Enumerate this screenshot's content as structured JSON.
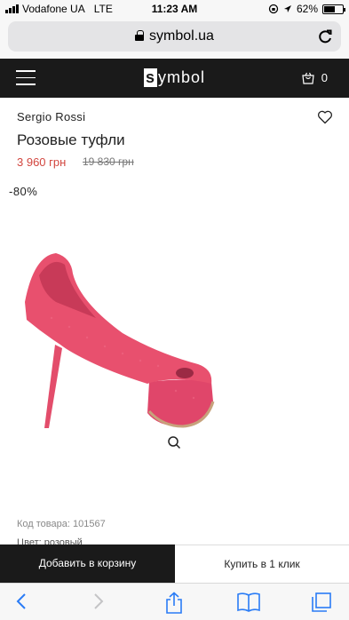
{
  "status_bar": {
    "carrier": "Vodafone UA",
    "network": "LTE",
    "time": "11:23 AM",
    "battery": "62%",
    "battery_level": 0.62
  },
  "browser": {
    "url": "symbol.ua"
  },
  "header": {
    "logo_box": "s",
    "logo_rest": "ymbol",
    "cart_count": "0"
  },
  "product": {
    "brand": "Sergio Rossi",
    "title": "Розовые туфли",
    "price_new": "3 960 грн",
    "price_old": "19 830 грн",
    "discount": "-80%",
    "sku": "Код товара: 101567",
    "color": "Цвет: розовый"
  },
  "actions": {
    "add_to_cart": "Добавить в корзину",
    "buy_one_click": "Купить в 1 клик"
  },
  "colors": {
    "header_bg": "#1a1a1a",
    "price_red": "#d2463f",
    "shoe_pink": "#e8506e",
    "ios_blue": "#2a7cf6"
  },
  "icons": [
    "lock-icon",
    "reload-icon",
    "menu-icon",
    "cart-icon",
    "heart-icon",
    "zoom-icon",
    "back-icon",
    "forward-icon",
    "share-icon",
    "bookmarks-icon",
    "tabs-icon"
  ]
}
